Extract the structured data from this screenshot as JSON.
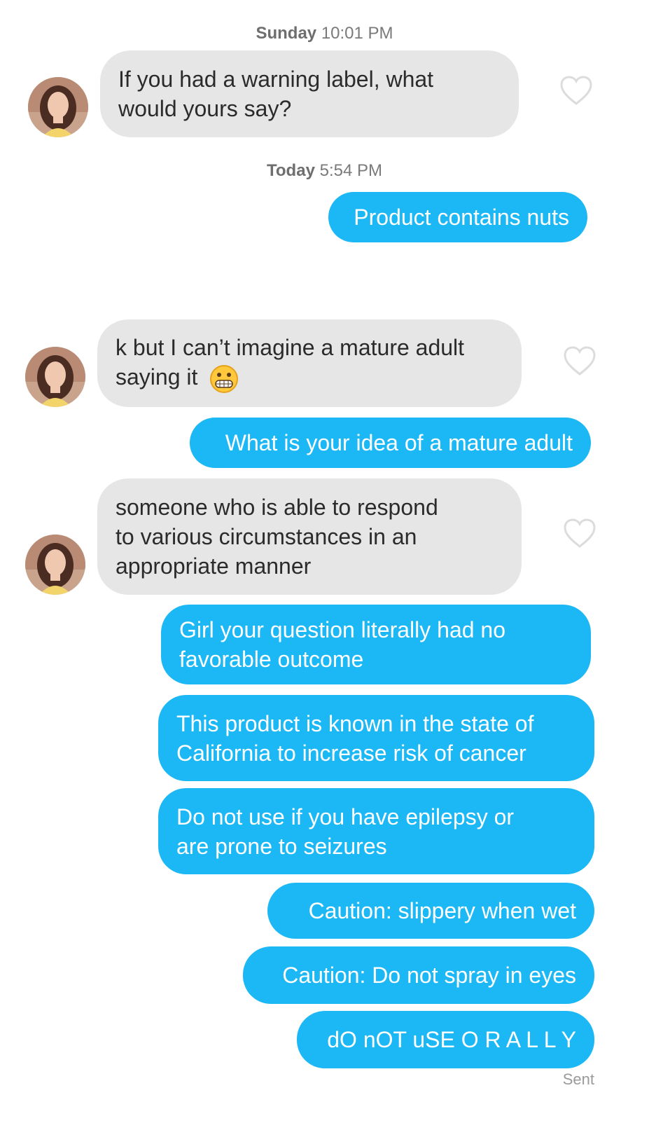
{
  "timestamps": [
    {
      "day": "Sunday",
      "time": "10:01 PM"
    },
    {
      "day": "Today",
      "time": "5:54 PM"
    }
  ],
  "messages": {
    "m1": "If you had a warning label, what",
    "m1b": "would yours say?",
    "m2": "Product contains nuts",
    "m3": "k but I can’t imagine a mature adult",
    "m3b": "saying it",
    "m4": "What is your idea of a mature adult",
    "m5a": "someone who is able to respond",
    "m5b": "to various circumstances in an",
    "m5c": "appropriate manner",
    "m6a": "Girl your question literally had no",
    "m6b": "favorable outcome",
    "m7a": "This product is known in the state of",
    "m7b": "California to increase risk of cancer",
    "m8a": "Do not use if you have epilepsy or",
    "m8b": "are prone to seizures",
    "m9": "Caution: slippery when wet",
    "m10": "Caution: Do not spray in eyes",
    "m11": "dO nOT uSE O R A L L Y"
  },
  "status": "Sent",
  "colors": {
    "outgoing": "#1cb8f5",
    "incoming": "#e6e6e6",
    "heart": "#dcdcdc"
  },
  "icons": [
    "avatar",
    "heart-icon",
    "grimacing-emoji-icon"
  ]
}
